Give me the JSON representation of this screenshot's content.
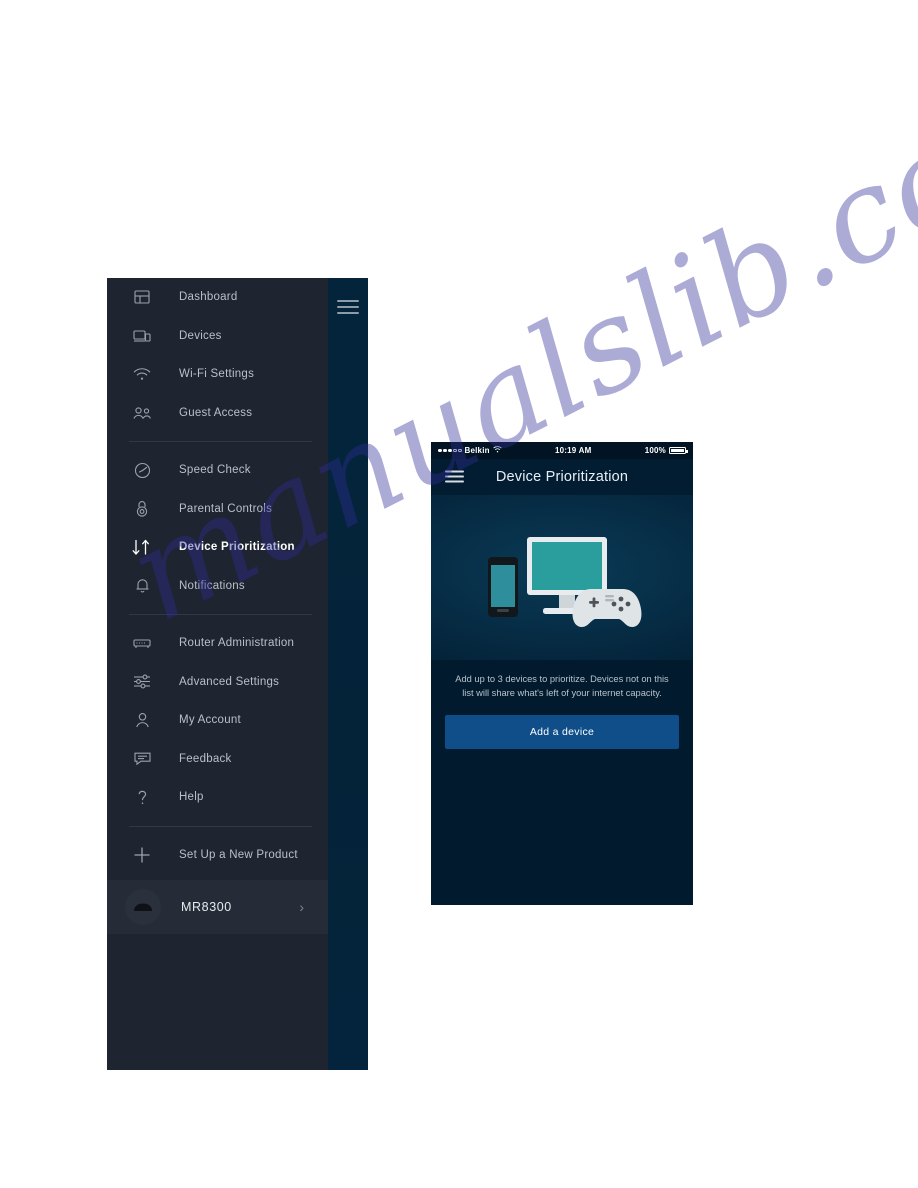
{
  "sidebar": {
    "hamburger_icon": "hamburger-menu-icon",
    "groups": [
      {
        "items": [
          {
            "label": "Dashboard",
            "icon": "dashboard-icon"
          },
          {
            "label": "Devices",
            "icon": "devices-icon"
          },
          {
            "label": "Wi-Fi Settings",
            "icon": "wifi-icon"
          },
          {
            "label": "Guest Access",
            "icon": "guest-users-icon"
          }
        ]
      },
      {
        "items": [
          {
            "label": "Speed Check",
            "icon": "speedometer-icon"
          },
          {
            "label": "Parental Controls",
            "icon": "padlock-icon"
          },
          {
            "label": "Device Prioritization",
            "icon": "up-down-arrows-icon",
            "active": true
          },
          {
            "label": "Notifications",
            "icon": "bell-icon"
          }
        ]
      },
      {
        "items": [
          {
            "label": "Router Administration",
            "icon": "router-icon"
          },
          {
            "label": "Advanced Settings",
            "icon": "sliders-icon"
          },
          {
            "label": "My Account",
            "icon": "person-icon"
          },
          {
            "label": "Feedback",
            "icon": "speech-bubble-icon"
          },
          {
            "label": "Help",
            "icon": "question-mark-icon"
          }
        ]
      },
      {
        "items": [
          {
            "label": "Set Up a New Product",
            "icon": "plus-icon"
          }
        ]
      }
    ],
    "router": {
      "name": "MR8300",
      "avatar_icon": "router-avatar-icon",
      "chevron_icon": "chevron-right-icon"
    }
  },
  "phone": {
    "status_bar": {
      "carrier": "Belkin",
      "wifi_icon": "wifi-icon",
      "time": "10:19 AM",
      "battery_percent": "100%",
      "battery_icon": "battery-full-icon"
    },
    "header": {
      "menu_icon": "hamburger-menu-icon",
      "title": "Device Prioritization"
    },
    "illustration": {
      "name": "devices-illustration",
      "items": [
        "smartphone",
        "desktop-monitor",
        "game-controller"
      ],
      "screen_color": "#2a9d9d"
    },
    "description": "Add up to 3 devices to prioritize. Devices not on this list will share what's left of your internet capacity.",
    "add_device_label": "Add a device",
    "accent_color": "#0f4e89"
  },
  "watermark": {
    "text": "manualslib.com"
  }
}
